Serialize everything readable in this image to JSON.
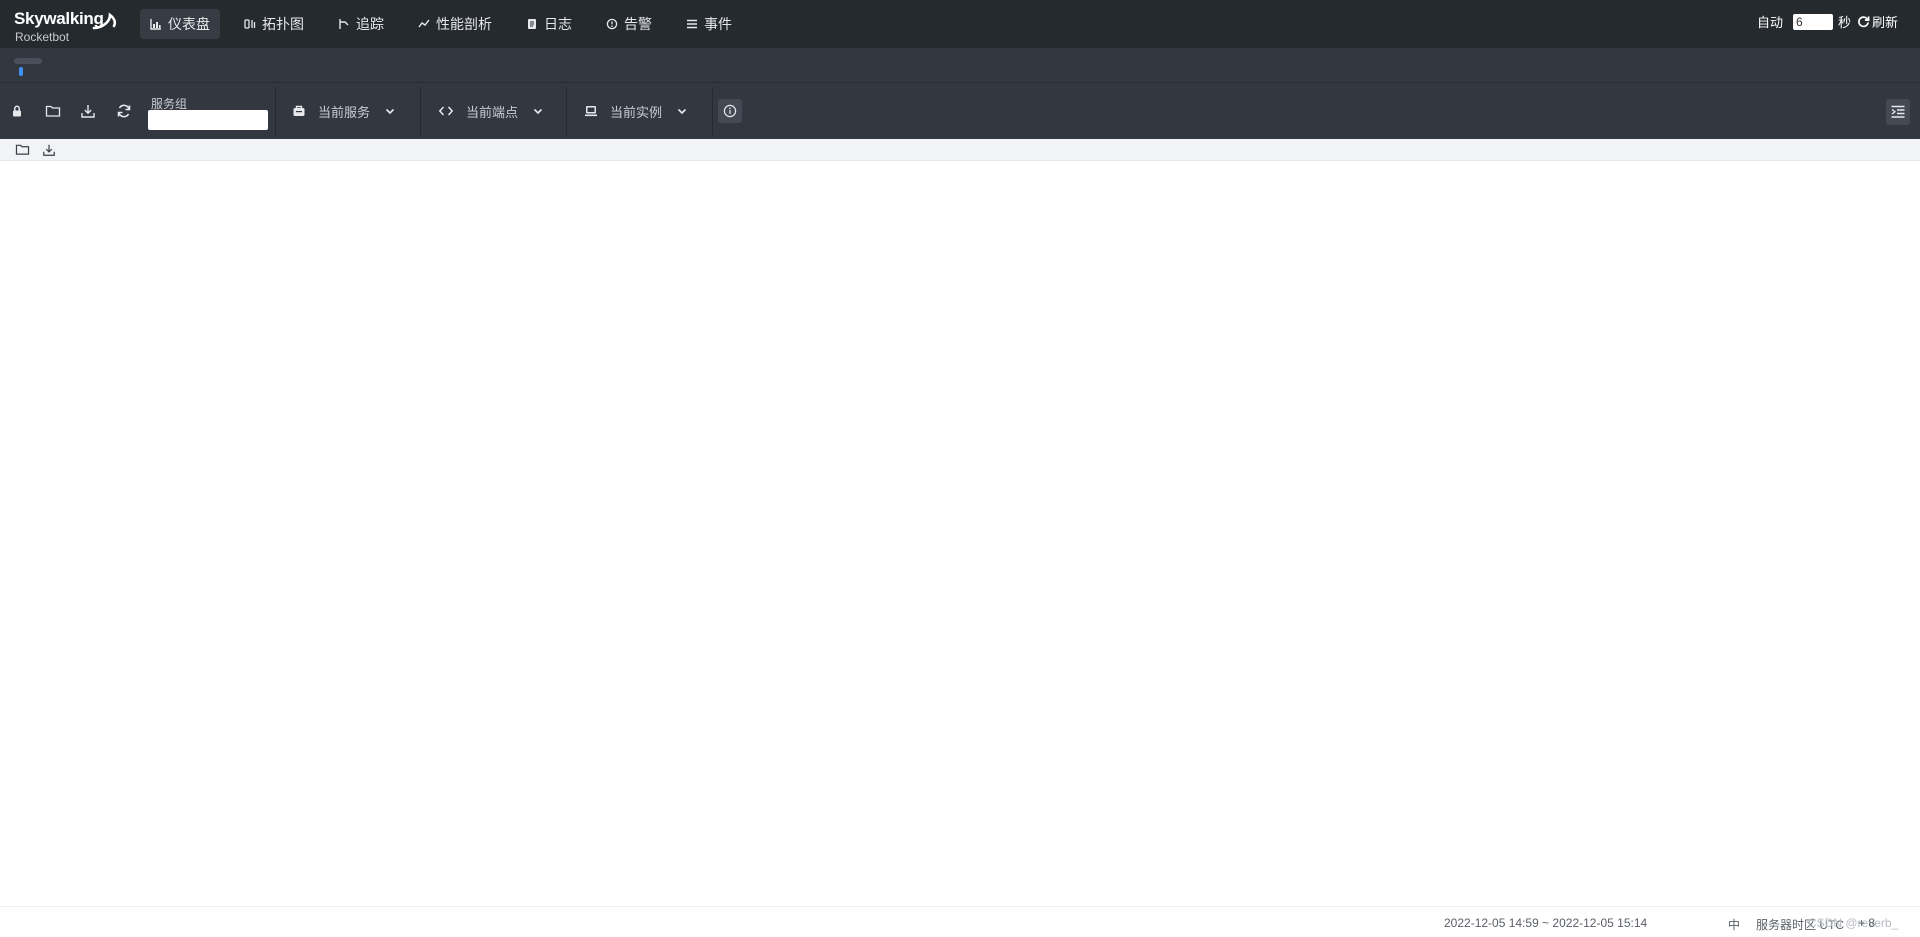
{
  "brand": {
    "name": "Skywalking",
    "sub": "Rocketbot"
  },
  "nav": [
    {
      "label": "仪表盘",
      "icon": "dashboard-icon",
      "active": true
    },
    {
      "label": "拓扑图",
      "icon": "topology-icon"
    },
    {
      "label": "追踪",
      "icon": "trace-icon"
    },
    {
      "label": "性能剖析",
      "icon": "profile-icon"
    },
    {
      "label": "日志",
      "icon": "log-icon"
    },
    {
      "label": "告警",
      "icon": "alarm-icon"
    },
    {
      "label": "事件",
      "icon": "event-icon"
    }
  ],
  "auto_refresh": {
    "auto_label": "自动",
    "interval": "6",
    "unit": "秒",
    "refresh_label": "刷新"
  },
  "toolbar": {
    "service_group_label": "服务组",
    "service_group_value": "",
    "service_label": "当前服务",
    "endpoint_label": "当前端点",
    "instance_label": "当前实例"
  },
  "footer": {
    "time_range": "2022-12-05 14:59 ~ 2022-12-05 15:14",
    "lang": "中",
    "timezone_label": "服务器时区 UTC",
    "timezone_value": "+ 8",
    "watermark": "CSDN @reverb_"
  },
  "colors": {
    "nav_bg": "#252a2f",
    "toolbar_bg": "#333840",
    "accent": "#3d92ff"
  }
}
